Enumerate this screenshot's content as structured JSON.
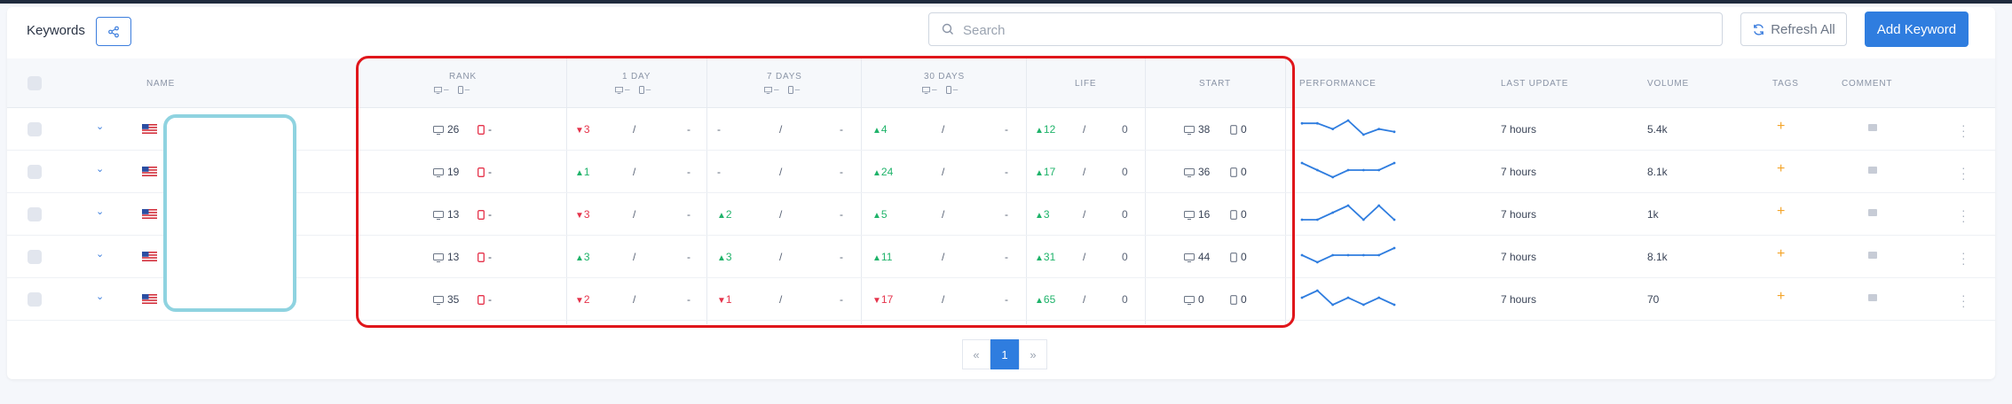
{
  "header": {
    "title": "Keywords",
    "search_placeholder": "Search",
    "refresh_label": "Refresh All",
    "add_label": "Add Keyword"
  },
  "columns": {
    "name": "NAME",
    "rank": "RANK",
    "day1": "1 DAY",
    "days7": "7 DAYS",
    "days30": "30 DAYS",
    "life": "LIFE",
    "start": "START",
    "performance": "PERFORMANCE",
    "last_update": "LAST UPDATE",
    "volume": "VOLUME",
    "tags": "TAGS",
    "comment": "COMMENT",
    "sub_dash": "–"
  },
  "rows": [
    {
      "rank_desktop": "26",
      "rank_mobile": "-",
      "day1": {
        "dir": "down",
        "value": "3",
        "sep": "/",
        "mobile": "-"
      },
      "days7": {
        "dir": "none",
        "value": "-",
        "sep": "/",
        "mobile": "-"
      },
      "days30": {
        "dir": "up",
        "value": "4",
        "sep": "/",
        "mobile": "-"
      },
      "life": {
        "dir": "up",
        "value": "12",
        "sep": "/",
        "mobile": "0"
      },
      "start_desktop": "38",
      "start_mobile": "0",
      "performance": [
        5,
        5,
        3,
        6,
        1,
        3,
        2
      ],
      "last_update": "7 hours",
      "volume": "5.4k",
      "tags": "+"
    },
    {
      "rank_desktop": "19",
      "rank_mobile": "-",
      "day1": {
        "dir": "up",
        "value": "1",
        "sep": "/",
        "mobile": "-"
      },
      "days7": {
        "dir": "none",
        "value": "-",
        "sep": "/",
        "mobile": "-"
      },
      "days30": {
        "dir": "up",
        "value": "24",
        "sep": "/",
        "mobile": "-"
      },
      "life": {
        "dir": "up",
        "value": "17",
        "sep": "/",
        "mobile": "0"
      },
      "start_desktop": "36",
      "start_mobile": "0",
      "performance": [
        5,
        4,
        3,
        4,
        4,
        4,
        5
      ],
      "last_update": "7 hours",
      "volume": "8.1k",
      "tags": "+"
    },
    {
      "rank_desktop": "13",
      "rank_mobile": "-",
      "day1": {
        "dir": "down",
        "value": "3",
        "sep": "/",
        "mobile": "-"
      },
      "days7": {
        "dir": "up",
        "value": "2",
        "sep": "/",
        "mobile": "-"
      },
      "days30": {
        "dir": "up",
        "value": "5",
        "sep": "/",
        "mobile": "-"
      },
      "life": {
        "dir": "up",
        "value": "3",
        "sep": "/",
        "mobile": "0"
      },
      "start_desktop": "16",
      "start_mobile": "0",
      "performance": [
        3,
        3,
        4,
        5,
        3,
        5,
        3
      ],
      "last_update": "7 hours",
      "volume": "1k",
      "tags": "+"
    },
    {
      "rank_desktop": "13",
      "rank_mobile": "-",
      "day1": {
        "dir": "up",
        "value": "3",
        "sep": "/",
        "mobile": "-"
      },
      "days7": {
        "dir": "up",
        "value": "3",
        "sep": "/",
        "mobile": "-"
      },
      "days30": {
        "dir": "up",
        "value": "11",
        "sep": "/",
        "mobile": "-"
      },
      "life": {
        "dir": "up",
        "value": "31",
        "sep": "/",
        "mobile": "0"
      },
      "start_desktop": "44",
      "start_mobile": "0",
      "performance": [
        4,
        3,
        4,
        4,
        4,
        4,
        5
      ],
      "last_update": "7 hours",
      "volume": "8.1k",
      "tags": "+"
    },
    {
      "rank_desktop": "35",
      "rank_mobile": "-",
      "day1": {
        "dir": "down",
        "value": "2",
        "sep": "/",
        "mobile": "-"
      },
      "days7": {
        "dir": "down",
        "value": "1",
        "sep": "/",
        "mobile": "-"
      },
      "days30": {
        "dir": "down",
        "value": "17",
        "sep": "/",
        "mobile": "-"
      },
      "life": {
        "dir": "up",
        "value": "65",
        "sep": "/",
        "mobile": "0"
      },
      "start_desktop": "0",
      "start_mobile": "0",
      "performance": [
        4,
        5,
        3,
        4,
        3,
        4,
        3
      ],
      "last_update": "7 hours",
      "volume": "70",
      "tags": "+"
    }
  ],
  "pagination": {
    "prev": "«",
    "current": "1",
    "next": "»"
  },
  "colors": {
    "accent": "#2f7ddf",
    "up": "#1fb36a",
    "down": "#e5334b",
    "highlight_box": "#e0161b",
    "redaction_box": "#8fd3e0"
  }
}
